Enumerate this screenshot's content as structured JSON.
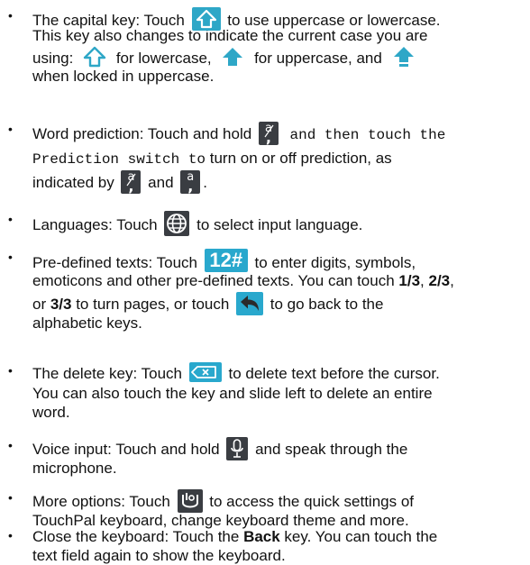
{
  "bullet_char": "•",
  "items": [
    {
      "lines": [
        [
          "The capital key: Touch ",
          {
            "icon": "capital-key-icon"
          },
          " to use uppercase or lowercase."
        ],
        [
          "This key also changes to indicate the current case you are"
        ],
        [
          "using: ",
          {
            "icon": "lowercase-icon"
          },
          " for lowercase, ",
          {
            "icon": "uppercase-icon"
          },
          " for uppercase, and ",
          {
            "icon": "capslock-icon"
          }
        ],
        [
          "when locked in uppercase."
        ]
      ]
    },
    {
      "lines": [
        [
          "Word prediction: Touch and hold ",
          {
            "icon": "prediction-key-icon"
          },
          {
            "mono": " and then touch the"
          }
        ],
        [
          {
            "mono": "Prediction switch to"
          },
          " turn on or off prediction, as"
        ],
        [
          "indicated by ",
          {
            "icon": "prediction-off-icon"
          },
          " and ",
          {
            "icon": "prediction-on-icon"
          },
          "."
        ]
      ]
    },
    {
      "lines": [
        [
          "Languages: Touch ",
          {
            "icon": "globe-icon"
          },
          " to select input language."
        ]
      ]
    },
    {
      "lines": [
        [
          "Pre-defined texts: Touch ",
          {
            "icon": "numbers-key-icon"
          },
          " to enter digits, symbols,"
        ],
        [
          "emoticons and other pre-defined texts. You can touch ",
          {
            "bold": "1/3"
          },
          ", ",
          {
            "bold": "2/3"
          },
          ","
        ],
        [
          "or ",
          {
            "bold": "3/3"
          },
          " to turn pages, or touch ",
          {
            "icon": "back-arrow-icon"
          },
          " to go back to the"
        ],
        [
          "alphabetic keys."
        ]
      ]
    },
    {
      "lines": [
        [
          "The delete key: Touch ",
          {
            "icon": "delete-key-icon"
          },
          " to delete text before the cursor."
        ],
        [
          "You can also touch the key and slide left to delete an entire"
        ],
        [
          "word."
        ]
      ]
    },
    {
      "lines": [
        [
          "Voice input: Touch and hold ",
          {
            "icon": "microphone-icon"
          },
          " and speak through the"
        ],
        [
          "microphone."
        ]
      ]
    },
    {
      "lines": [
        [
          "More options: Touch ",
          {
            "icon": "touchpal-options-icon"
          },
          " to access the quick settings of"
        ],
        [
          "TouchPal keyboard, change keyboard theme and more."
        ]
      ]
    },
    {
      "lines": [
        [
          "Close the keyboard: Touch the ",
          {
            "bold": "Back"
          },
          " key. You can touch the"
        ],
        [
          "text field again to show the keyboard."
        ]
      ]
    }
  ],
  "icon_labels": {
    "numbers-key-icon": "12#",
    "prediction-key-glyph": "a",
    "prediction-key-sub": ","
  },
  "colors": {
    "key_blue": "#2ea7c7",
    "key_dark": "#3a3d42"
  }
}
